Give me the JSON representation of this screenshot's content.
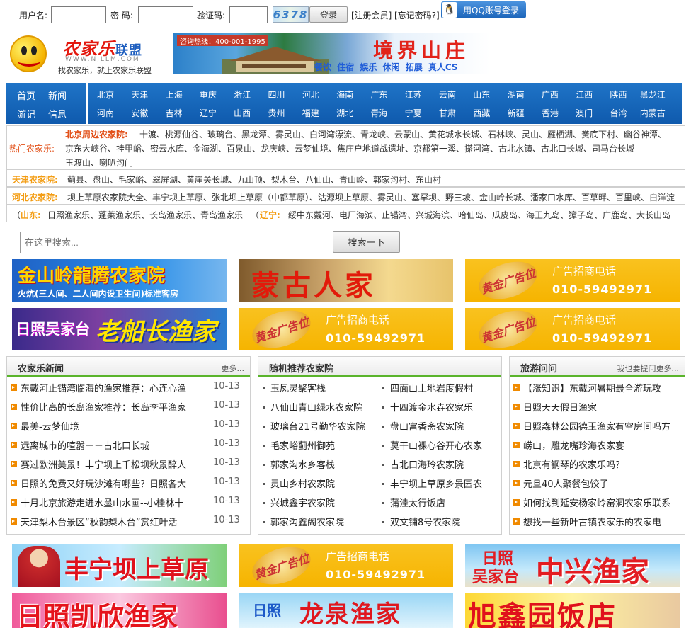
{
  "login": {
    "username_label": "用户名:",
    "password_label": "密  码:",
    "captcha_label": "验证码:",
    "captcha_text": "6378",
    "login_button": "登录",
    "register_link": "[注册会员]",
    "forgot_link": "[忘记密码?]",
    "qq_button": "用QQ账号登录"
  },
  "logo": {
    "title": "农家乐",
    "title_suffix": "联盟",
    "url": "WWW.NJLLM.COM",
    "slogan": "找农家乐，就上农家乐联盟"
  },
  "top_banner": {
    "hotline": "咨询热线：400-001-1995",
    "name": "境界山庄",
    "services": "餐饮 住宿 娱乐 休闲 拓展 真人CS"
  },
  "nav": {
    "main": [
      "首页",
      "新闻",
      "游记",
      "信息"
    ],
    "provinces_row1": [
      "北京",
      "天津",
      "上海",
      "重庆",
      "浙江",
      "四川",
      "河北",
      "海南",
      "广东",
      "江苏",
      "云南",
      "山东",
      "湖南",
      "广西",
      "江西",
      "陕西",
      "黑龙江"
    ],
    "provinces_row2": [
      "河南",
      "安徽",
      "吉林",
      "辽宁",
      "山西",
      "贵州",
      "福建",
      "湖北",
      "青海",
      "宁夏",
      "甘肃",
      "西藏",
      "新疆",
      "香港",
      "澳门",
      "台湾",
      "内蒙古"
    ]
  },
  "hot": {
    "label": "热门农家乐:",
    "beijing_label": "北京周边农家院:",
    "beijing_line1": "十渡、桃源仙谷、玻璃台、黑龙潭、雾灵山、白河湾漂流、青龙峡、云蒙山、黄花城水长城、石林峡、灵山、雁栖湖、黉底下村、幽谷神潭、",
    "beijing_line2": "京东大峡谷、挂甲峪、密云水库、金海湖、百泉山、龙庆峡、云梦仙境、焦庄户地道战遗址、京都第一溪、搽河湾、古北水镇、古北口长城、司马台长城",
    "beijing_line3": "玉渡山、喇叭沟门",
    "tianjin_label": "天津农家院:",
    "tianjin_text": "蓟县、盘山、毛家峪、翠屏湖、黄崖关长城、九山顶、梨木台、八仙山、青山岭、郭家沟村、东山村",
    "hebei_label": "河北农家院:",
    "hebei_text": "坝上草原农家院大全、丰宁坝上草原、张北坝上草原（中都草原）、沽源坝上草原、雾灵山、塞罕坝、野三坡、金山岭长城、潘家口水库、百草畔、百里峡、白洋淀",
    "shandong_label": "山东:",
    "shandong_text": "日照渔家乐、蓬莱渔家乐、长岛渔家乐、青岛渔家乐",
    "liaoning_label": "辽宁:",
    "liaoning_text": "绥中东戴河、电厂海滨、止锚湾、兴城海滨、哈仙岛、瓜皮岛、海王九岛、獐子岛、广鹿岛、大长山岛"
  },
  "search": {
    "placeholder": "在这里搜索...",
    "button": "搜索一下"
  },
  "ads": {
    "jinshanling_title": "金山岭龍腾农家院",
    "jinshanling_sub": "火炕(三人间、二人间内设卫生间)标准客房",
    "menggu": "蒙古人家",
    "gold_badge": "黄金广告位",
    "gold_line1": "广告招商电话",
    "gold_phone": "010-59492971",
    "rizhao_wujiatai": "日照吴家台",
    "laochuanzhang": "老船长渔家",
    "fengning": "丰宁坝上草原",
    "zhongxing_a": "日照",
    "zhongxing_b": "吴家台",
    "zhongxing_name": "中兴渔家",
    "kaixin": "日照凯欣渔家",
    "longquan_a": "日照",
    "longquan_name": "龙泉渔家",
    "xuxin": "旭鑫园饭店"
  },
  "news": {
    "title": "农家乐新闻",
    "more": "更多...",
    "items": [
      {
        "t": "东戴河止锚湾临海的渔家推荐：心连心渔",
        "d": "10-13"
      },
      {
        "t": "性价比高的长岛渔家推荐：长岛李平渔家",
        "d": "10-13"
      },
      {
        "t": "最美-云梦仙境",
        "d": "10-13"
      },
      {
        "t": "远离城市的喧嚣－－古北口长城",
        "d": "10-13"
      },
      {
        "t": "赛过欧洲美景！丰宁坝上千松坝秋景醉人",
        "d": "10-13"
      },
      {
        "t": "日照的免费又好玩沙滩有哪些？日照各大",
        "d": "10-13"
      },
      {
        "t": "十月北京旅游走进水墨山水画--小桂林十",
        "d": "10-13"
      },
      {
        "t": "天津梨木台景区“秋韵梨木台”赏红叶活",
        "d": "10-13"
      }
    ]
  },
  "random": {
    "title": "随机推荐农家院",
    "left": [
      "玉凤灵聚客栈",
      "八仙山青山绿水农家院",
      "玻璃台21号勤华农家院",
      "毛家峪蓟州御苑",
      "郭家沟水乡客栈",
      "灵山乡村农家院",
      "兴城鑫宇农家院",
      "郭家沟鑫阁农家院"
    ],
    "right": [
      "四面山土地岩度假村",
      "十四渡金水垚农家乐",
      "盘山富香斋农家院",
      "莫干山裸心谷开心农家",
      "古北口海玲农家院",
      "丰宁坝上草原乡景园农",
      "蒲洼太行饭店",
      "双文铺8号农家院"
    ]
  },
  "qa": {
    "title": "旅游问问",
    "more": "我也要提问更多...",
    "items": [
      "【涨知识】东戴河暑期最全游玩攻",
      "日照天天假日渔家",
      "日照森林公园德玉渔家有空房间吗方",
      "崂山，雕龙嘴珍海农家宴",
      "北京有钢琴的农家乐吗？",
      "元旦40人聚餐包饺子",
      "如何找到延安杨家岭窑洞农家乐联系",
      "想找一些新叶古镇农家乐的农家电"
    ]
  }
}
